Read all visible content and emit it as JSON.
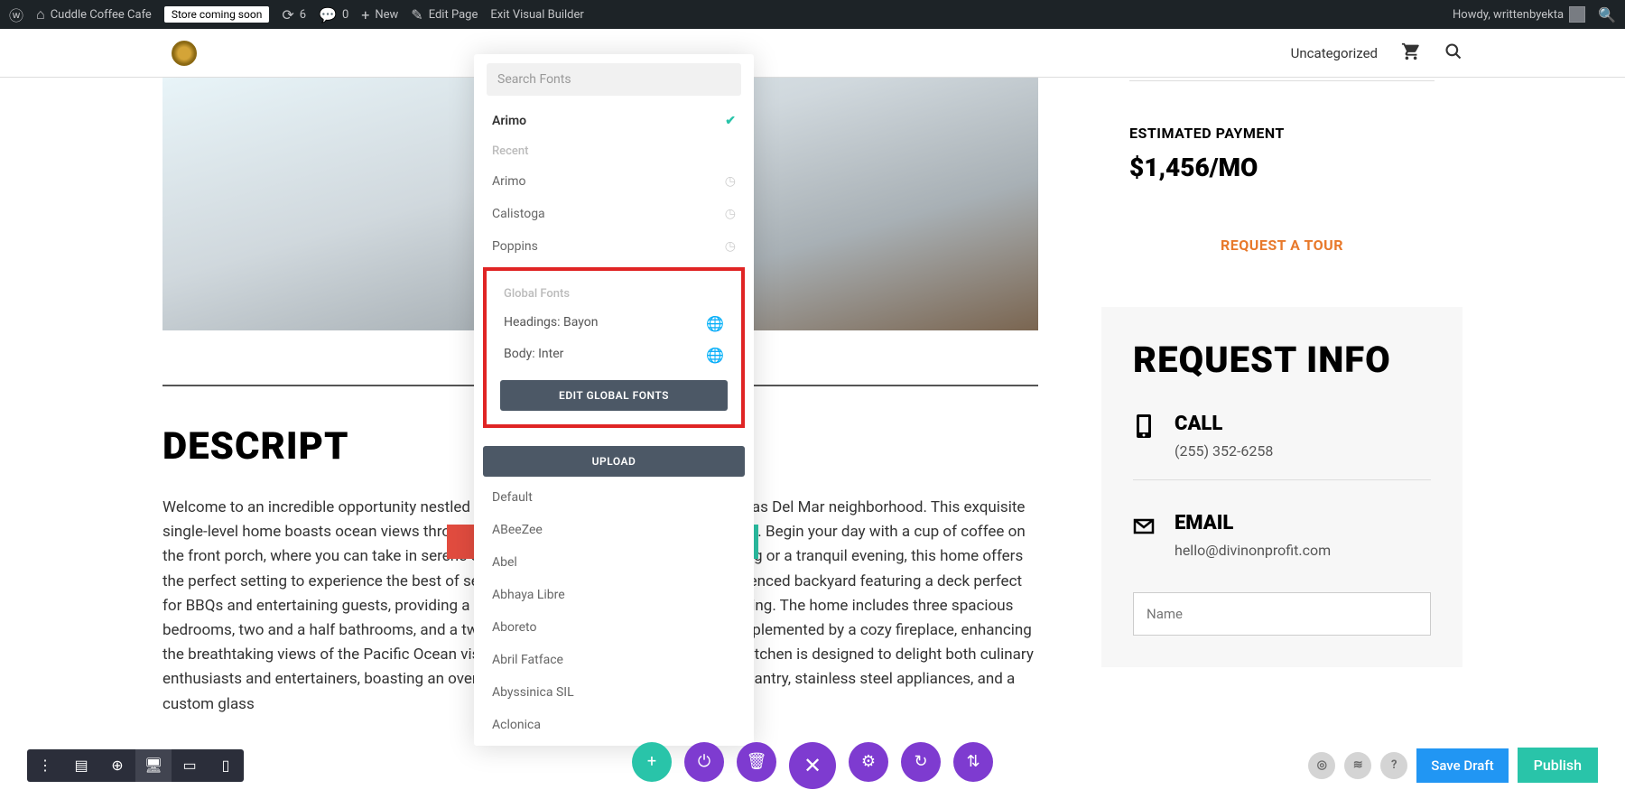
{
  "wp_bar": {
    "site_name": "Cuddle Coffee Cafe",
    "store_status": "Store coming soon",
    "updates": "6",
    "comments": "0",
    "new": "New",
    "edit_page": "Edit Page",
    "exit_vb": "Exit Visual Builder",
    "howdy": "Howdy, writtenbyekta"
  },
  "site_nav": {
    "uncategorized": "Uncategorized"
  },
  "font_dropdown": {
    "search_placeholder": "Search Fonts",
    "selected": "Arimo",
    "recent_label": "Recent",
    "recent": [
      "Arimo",
      "Calistoga",
      "Poppins"
    ],
    "global_label": "Global Fonts",
    "global_headings": "Headings: Bayon",
    "global_body": "Body: Inter",
    "edit_global_btn": "EDIT GLOBAL FONTS",
    "upload_btn": "UPLOAD",
    "all_fonts": [
      "Default",
      "ABeeZee",
      "Abel",
      "Abhaya Libre",
      "Aboreto",
      "Abril Fatface",
      "Abyssinica SIL",
      "Aclonica"
    ]
  },
  "sidebar": {
    "est_label": "ESTIMATED PAYMENT",
    "est_price": "$1,456/MO",
    "tour_btn": "REQUEST A TOUR",
    "request_title": "REQUEST INFO",
    "call_label": "CALL",
    "call_value": "(255) 352-6258",
    "email_label": "EMAIL",
    "email_value": "hello@divinonprofit.com",
    "name_placeholder": "Name"
  },
  "page": {
    "desc_title": "DESCRIPT",
    "desc_text": "Welcome to an incredible opportunity nestled within the highly sought-after Las Ventanas Del Mar neighborhood. This exquisite single-level home boasts ocean views throughout its living spaces, making it a true gem. Begin your day with a cup of coffee on the front porch, where you can take in serene ocean sights. Whether it's a sunny morning or a tranquil evening, this home offers the perfect setting to experience the best of seaside living. Enjoy ample privacy in the fenced backyard featuring a deck perfect for BBQs and entertaining guests, providing a seamless blend of indoor and outdoor living. The home includes three spacious bedrooms, two and a half bathrooms, and a two-car garage. The open floor plan is complemented by a cozy fireplace, enhancing the breathtaking views of the Pacific Ocean visible through an oversized window. The kitchen is designed to delight both culinary enthusiasts and entertainers, boasting an oversized island with a utility sink, a walk-in pantry, stainless steel appliances, and a custom glass"
  },
  "bottom_bar": {
    "save_draft": "Save Draft",
    "publish": "Publish"
  }
}
